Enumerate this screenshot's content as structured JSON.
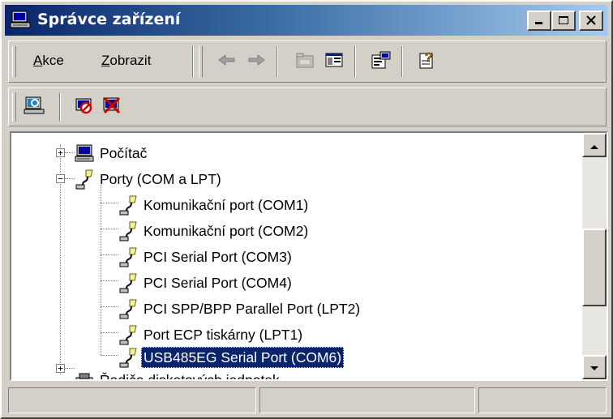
{
  "window": {
    "title": "Správce zařízení",
    "app_icon": "computer-icon",
    "controls": [
      "minimize-icon",
      "maximize-icon",
      "close-icon"
    ]
  },
  "menu": {
    "items": [
      {
        "label": "Akce",
        "accel": "A",
        "rest": "kce"
      },
      {
        "label": "Zobrazit",
        "accel": "Z",
        "rest": "obrazit"
      }
    ]
  },
  "toolbar": {
    "buttons": [
      "back-arrow-icon",
      "forward-arrow-icon",
      "up-folder-icon",
      "show-hide-tree-icon",
      "properties-icon",
      "help-icon"
    ]
  },
  "toolbar2": {
    "buttons": [
      "scan-hardware-icon",
      "disable-device-icon",
      "uninstall-device-icon"
    ]
  },
  "tree": {
    "items": [
      {
        "label": "Počítač",
        "icon": "computer-icon",
        "level": 0,
        "expander": "+"
      },
      {
        "label": "Porty (COM a LPT)",
        "icon": "port-icon",
        "level": 0,
        "expander": "−"
      },
      {
        "label": "Komunikační port (COM1)",
        "icon": "port-icon",
        "level": 1
      },
      {
        "label": "Komunikační port (COM2)",
        "icon": "port-icon",
        "level": 1
      },
      {
        "label": "PCI Serial Port (COM3)",
        "icon": "port-icon",
        "level": 1
      },
      {
        "label": "PCI Serial Port (COM4)",
        "icon": "port-icon",
        "level": 1
      },
      {
        "label": "PCI SPP/BPP Parallel Port (LPT2)",
        "icon": "port-icon",
        "level": 1
      },
      {
        "label": "Port ECP tiskárny (LPT1)",
        "icon": "port-icon",
        "level": 1
      },
      {
        "label": "USB485EG Serial Port (COM6)",
        "icon": "port-icon",
        "level": 1,
        "selected": true
      },
      {
        "label": "Řadiče disketových jednotek",
        "icon": "floppy-controller-icon",
        "level": 0,
        "expander": "+"
      }
    ]
  },
  "statusbar": {
    "panels": [
      "",
      "",
      ""
    ]
  },
  "colors": {
    "titlebar_start": "#0a246a",
    "titlebar_end": "#a6caf0",
    "selection": "#0a246a",
    "face": "#d4d0c8"
  }
}
